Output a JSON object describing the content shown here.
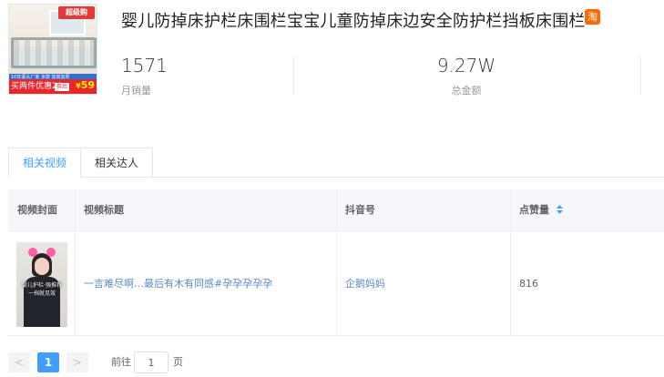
{
  "product": {
    "title": "婴儿防掉床护栏床围栏宝宝儿童防掉床边安全防护栏挡板床围栏",
    "platform_badge": "淘",
    "thumbnail": {
      "badge_top": "超级购",
      "promo_line": "10年源头厂家 多款 加高加厚",
      "promo_text": "买两件优惠20",
      "promo_tag": "券后",
      "price": "59"
    }
  },
  "stats": {
    "monthly_sales": {
      "value": "1571",
      "label": "月销量"
    },
    "total_amount": {
      "value": "9.27W",
      "label": "总金额"
    }
  },
  "tabs": [
    {
      "label": "相关视频",
      "active": true
    },
    {
      "label": "相关达人",
      "active": false
    }
  ],
  "table": {
    "columns": [
      "视频封面",
      "视频标题",
      "抖音号",
      "点赞量"
    ],
    "rows": [
      {
        "cover_caption_1": "婴儿护栏·强推荐",
        "cover_caption_2": "一挡就见效",
        "title": "一言难尽啊…最后有木有同感#孕孕孕孕孕",
        "account": "企鹅妈妈",
        "likes": "816"
      }
    ]
  },
  "pagination": {
    "prev": "<",
    "current_page": "1",
    "next": ">",
    "goto_label": "前往",
    "goto_value": "1",
    "goto_suffix": "页"
  },
  "colors": {
    "accent": "#409eff",
    "link": "#5a8ac8",
    "platform_badge": "#ff6a00",
    "header_bg": "#f5f7fa"
  }
}
